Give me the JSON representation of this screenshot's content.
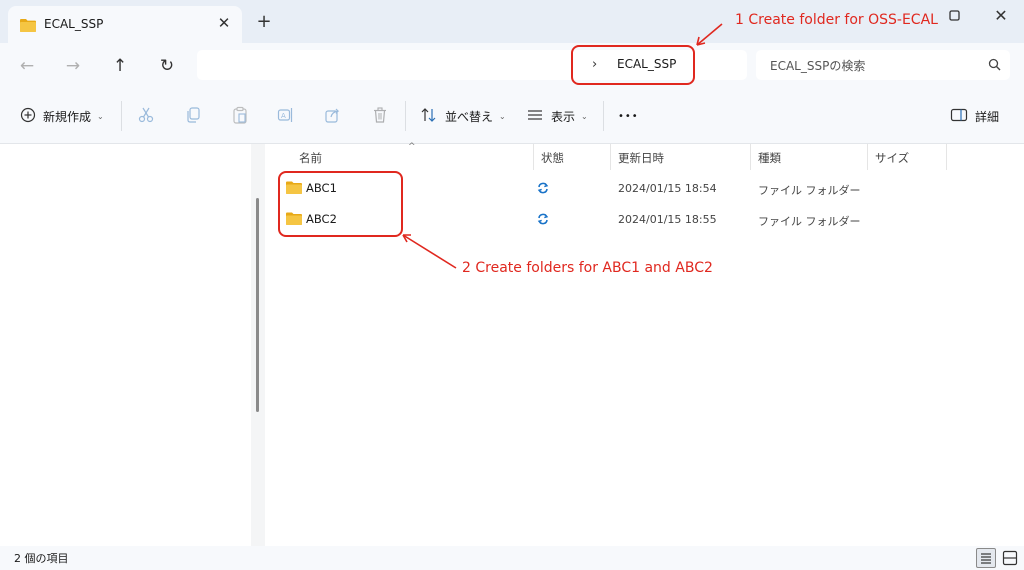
{
  "window": {
    "tab_title": "ECAL_SSP",
    "new_tab": "+",
    "close_tab": "✕",
    "close_window": "✕"
  },
  "nav": {
    "back": "←",
    "forward": "→",
    "up": "↑",
    "refresh": "↻"
  },
  "address": {
    "chevron": "›",
    "current": "ECAL_SSP"
  },
  "search": {
    "placeholder": "ECAL_SSPの検索"
  },
  "toolbar": {
    "new_label": "新規作成",
    "sort_label": "並べ替え",
    "view_label": "表示",
    "more_label": "•••",
    "details_label": "詳細",
    "caret": "⌄"
  },
  "columns": {
    "name": "名前",
    "status": "状態",
    "modified": "更新日時",
    "type": "種類",
    "size": "サイズ",
    "sort_caret": "^"
  },
  "files": [
    {
      "name": "ABC1",
      "modified": "2024/01/15 18:54",
      "type": "ファイル フォルダー"
    },
    {
      "name": "ABC2",
      "modified": "2024/01/15 18:55",
      "type": "ファイル フォルダー"
    }
  ],
  "status": {
    "item_count": "2 個の項目"
  },
  "annotations": {
    "note1": "1 Create folder for OSS-ECAL",
    "note2": "2 Create folders for ABC1 and ABC2",
    "color": "#e0281f"
  },
  "colors": {
    "folder": "#f2c14e",
    "sync": "#1a73c8",
    "chrome": "#e8eef6"
  }
}
